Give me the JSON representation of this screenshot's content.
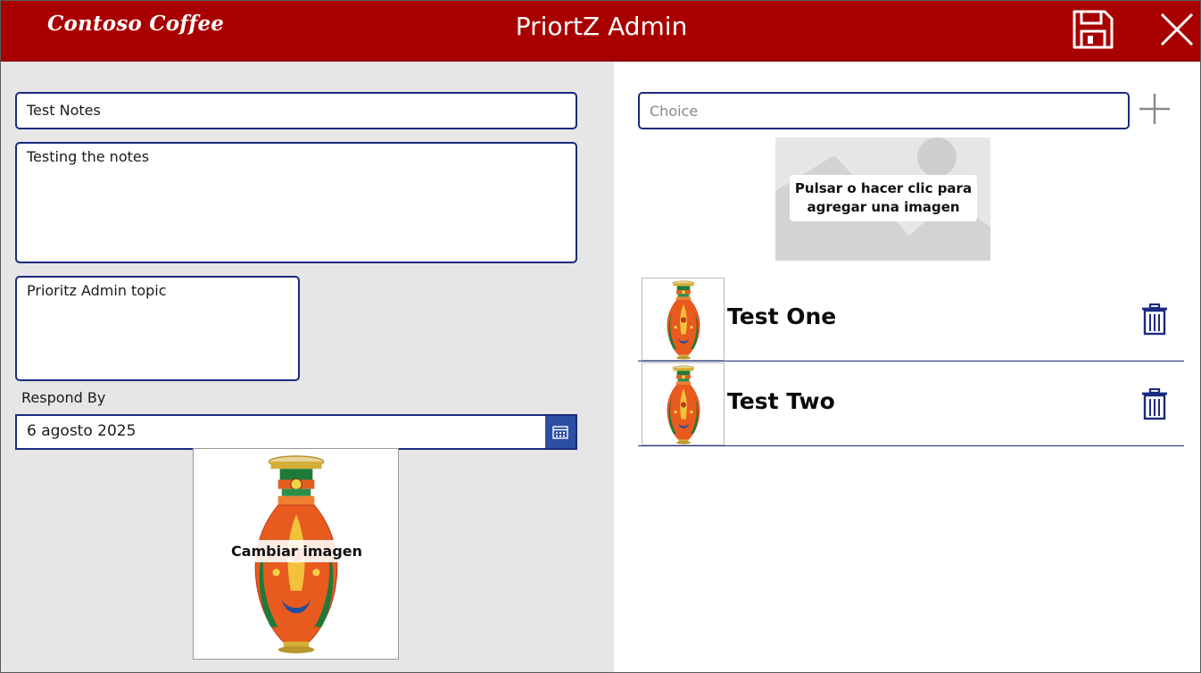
{
  "header": {
    "logo": "Contoso Coffee",
    "title": "PriortZ Admin",
    "save_icon": "save-icon",
    "close_icon": "close-icon"
  },
  "form": {
    "title_value": "Test Notes",
    "notes_value": "Testing the notes",
    "topic_value": "Prioritz Admin topic",
    "respond_by_label": "Respond By",
    "respond_by_value": "6 agosto 2025",
    "calendar_icon": "calendar-icon",
    "change_image_label": "Cambiar imagen"
  },
  "choices": {
    "placeholder": "Choice",
    "add_icon": "plus-icon",
    "add_image_label": "Pulsar o hacer clic para agregar una imagen"
  },
  "gallery": {
    "items": [
      {
        "title": "Test One",
        "icon": "trash-icon"
      },
      {
        "title": "Test Two",
        "icon": "trash-icon"
      }
    ]
  },
  "colors": {
    "header_bg": "#a80000",
    "accent": "#1a2a80",
    "calendar_button": "#2c4fa3",
    "left_panel_bg": "#e6e6e6"
  }
}
